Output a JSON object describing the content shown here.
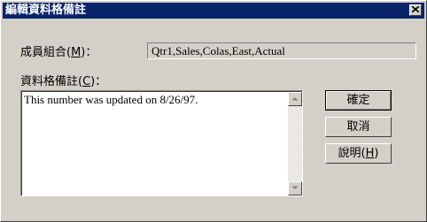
{
  "dialog": {
    "title": "編輯資料格備註",
    "close_symbol": "×"
  },
  "member_combo": {
    "label_prefix": "成員組合(",
    "label_mnemonic": "M",
    "label_suffix": ")：",
    "value": "Qtr1,Sales,Colas,East,Actual"
  },
  "cell_note": {
    "label_prefix": "資料格備註(",
    "label_mnemonic": "C",
    "label_suffix": ")：",
    "value": "This number was updated on 8/26/97."
  },
  "buttons": {
    "ok_label": "確定",
    "cancel_label": "取消",
    "help_prefix": "說明(",
    "help_mnemonic": "H",
    "help_suffix": ")"
  },
  "colors": {
    "title_bar": "#0a246a",
    "face": "#d4d0c8"
  }
}
